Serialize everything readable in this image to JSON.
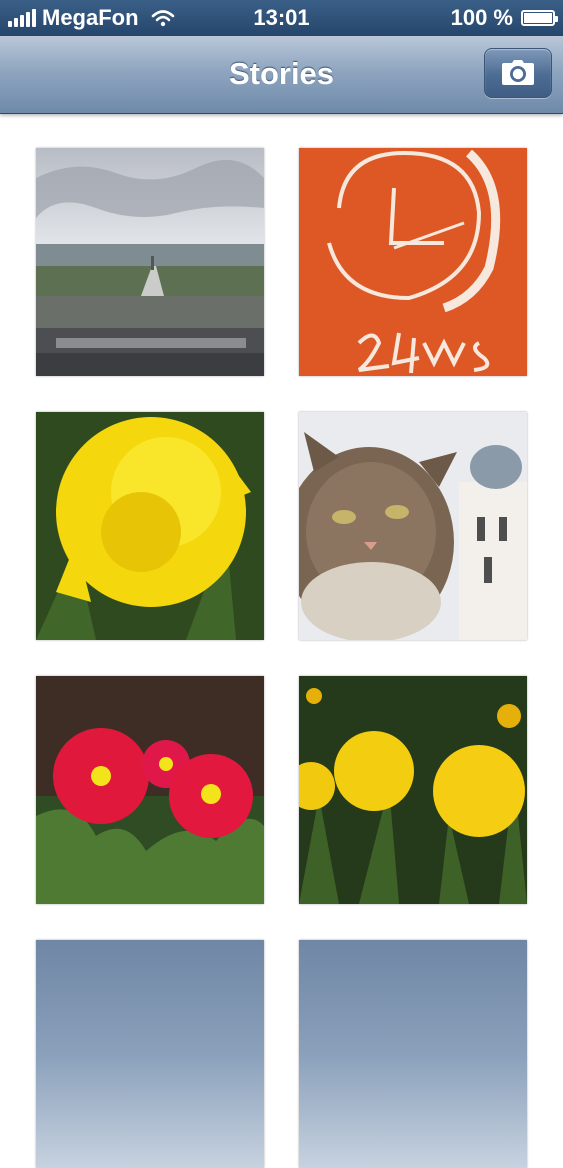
{
  "status_bar": {
    "carrier": "MegaFon",
    "time": "13:01",
    "battery": "100 %",
    "icons": [
      "signal-bars-icon",
      "wifi-icon",
      "battery-icon"
    ]
  },
  "nav_bar": {
    "title": "Stories",
    "right_button_icon": "camera-icon"
  },
  "photos": [
    {
      "subject": "coastal-city-view"
    },
    {
      "subject": "clock-drawing-on-orange"
    },
    {
      "subject": "yellow-dandelion-closeup"
    },
    {
      "subject": "tabby-cat-with-church"
    },
    {
      "subject": "red-daisies-on-soil"
    },
    {
      "subject": "dandelions-in-grass"
    },
    {
      "subject": "loading-placeholder"
    },
    {
      "subject": "loading-placeholder"
    }
  ],
  "colors": {
    "status_bar": "#2f5178",
    "nav_bar": "#8fa6c0",
    "nav_title": "#ffffff",
    "background": "#ffffff"
  }
}
